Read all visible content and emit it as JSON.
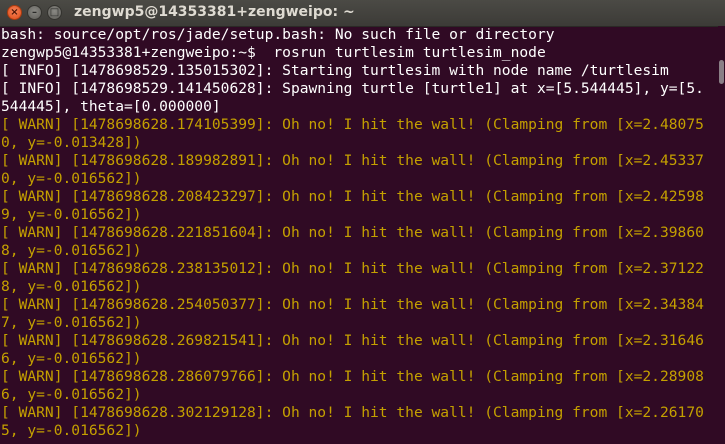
{
  "window": {
    "title": "zengwp5@14353381+zengweipo: ~",
    "close_glyph": "×",
    "minimize_glyph": "–",
    "maximize_glyph": "□"
  },
  "colors": {
    "terminal_background": "#300a24",
    "text": "#ffffff",
    "warn_text": "#c4a000"
  },
  "terminal": {
    "lines": [
      {
        "type": "normal",
        "text": "bash: source/opt/ros/jade/setup.bash: No such file or directory"
      },
      {
        "type": "normal",
        "text": "zengwp5@14353381+zengweipo:~$  rosrun turtlesim turtlesim_node"
      },
      {
        "type": "normal",
        "text": "[ INFO] [1478698529.135015302]: Starting turtlesim with node name /turtlesim"
      },
      {
        "type": "normal",
        "text": "[ INFO] [1478698529.141450628]: Spawning turtle [turtle1] at x=[5.544445], y=[5."
      },
      {
        "type": "normal",
        "text": "544445], theta=[0.000000]"
      },
      {
        "type": "warn",
        "text": "[ WARN] [1478698628.174105399]: Oh no! I hit the wall! (Clamping from [x=2.48075"
      },
      {
        "type": "warn",
        "text": "0, y=-0.013428])"
      },
      {
        "type": "warn",
        "text": "[ WARN] [1478698628.189982891]: Oh no! I hit the wall! (Clamping from [x=2.45337"
      },
      {
        "type": "warn",
        "text": "0, y=-0.016562])"
      },
      {
        "type": "warn",
        "text": "[ WARN] [1478698628.208423297]: Oh no! I hit the wall! (Clamping from [x=2.42598"
      },
      {
        "type": "warn",
        "text": "9, y=-0.016562])"
      },
      {
        "type": "warn",
        "text": "[ WARN] [1478698628.221851604]: Oh no! I hit the wall! (Clamping from [x=2.39860"
      },
      {
        "type": "warn",
        "text": "8, y=-0.016562])"
      },
      {
        "type": "warn",
        "text": "[ WARN] [1478698628.238135012]: Oh no! I hit the wall! (Clamping from [x=2.37122"
      },
      {
        "type": "warn",
        "text": "8, y=-0.016562])"
      },
      {
        "type": "warn",
        "text": "[ WARN] [1478698628.254050377]: Oh no! I hit the wall! (Clamping from [x=2.34384"
      },
      {
        "type": "warn",
        "text": "7, y=-0.016562])"
      },
      {
        "type": "warn",
        "text": "[ WARN] [1478698628.269821541]: Oh no! I hit the wall! (Clamping from [x=2.31646"
      },
      {
        "type": "warn",
        "text": "6, y=-0.016562])"
      },
      {
        "type": "warn",
        "text": "[ WARN] [1478698628.286079766]: Oh no! I hit the wall! (Clamping from [x=2.28908"
      },
      {
        "type": "warn",
        "text": "6, y=-0.016562])"
      },
      {
        "type": "warn",
        "text": "[ WARN] [1478698628.302129128]: Oh no! I hit the wall! (Clamping from [x=2.26170"
      },
      {
        "type": "warn",
        "text": "5, y=-0.016562])"
      }
    ]
  }
}
